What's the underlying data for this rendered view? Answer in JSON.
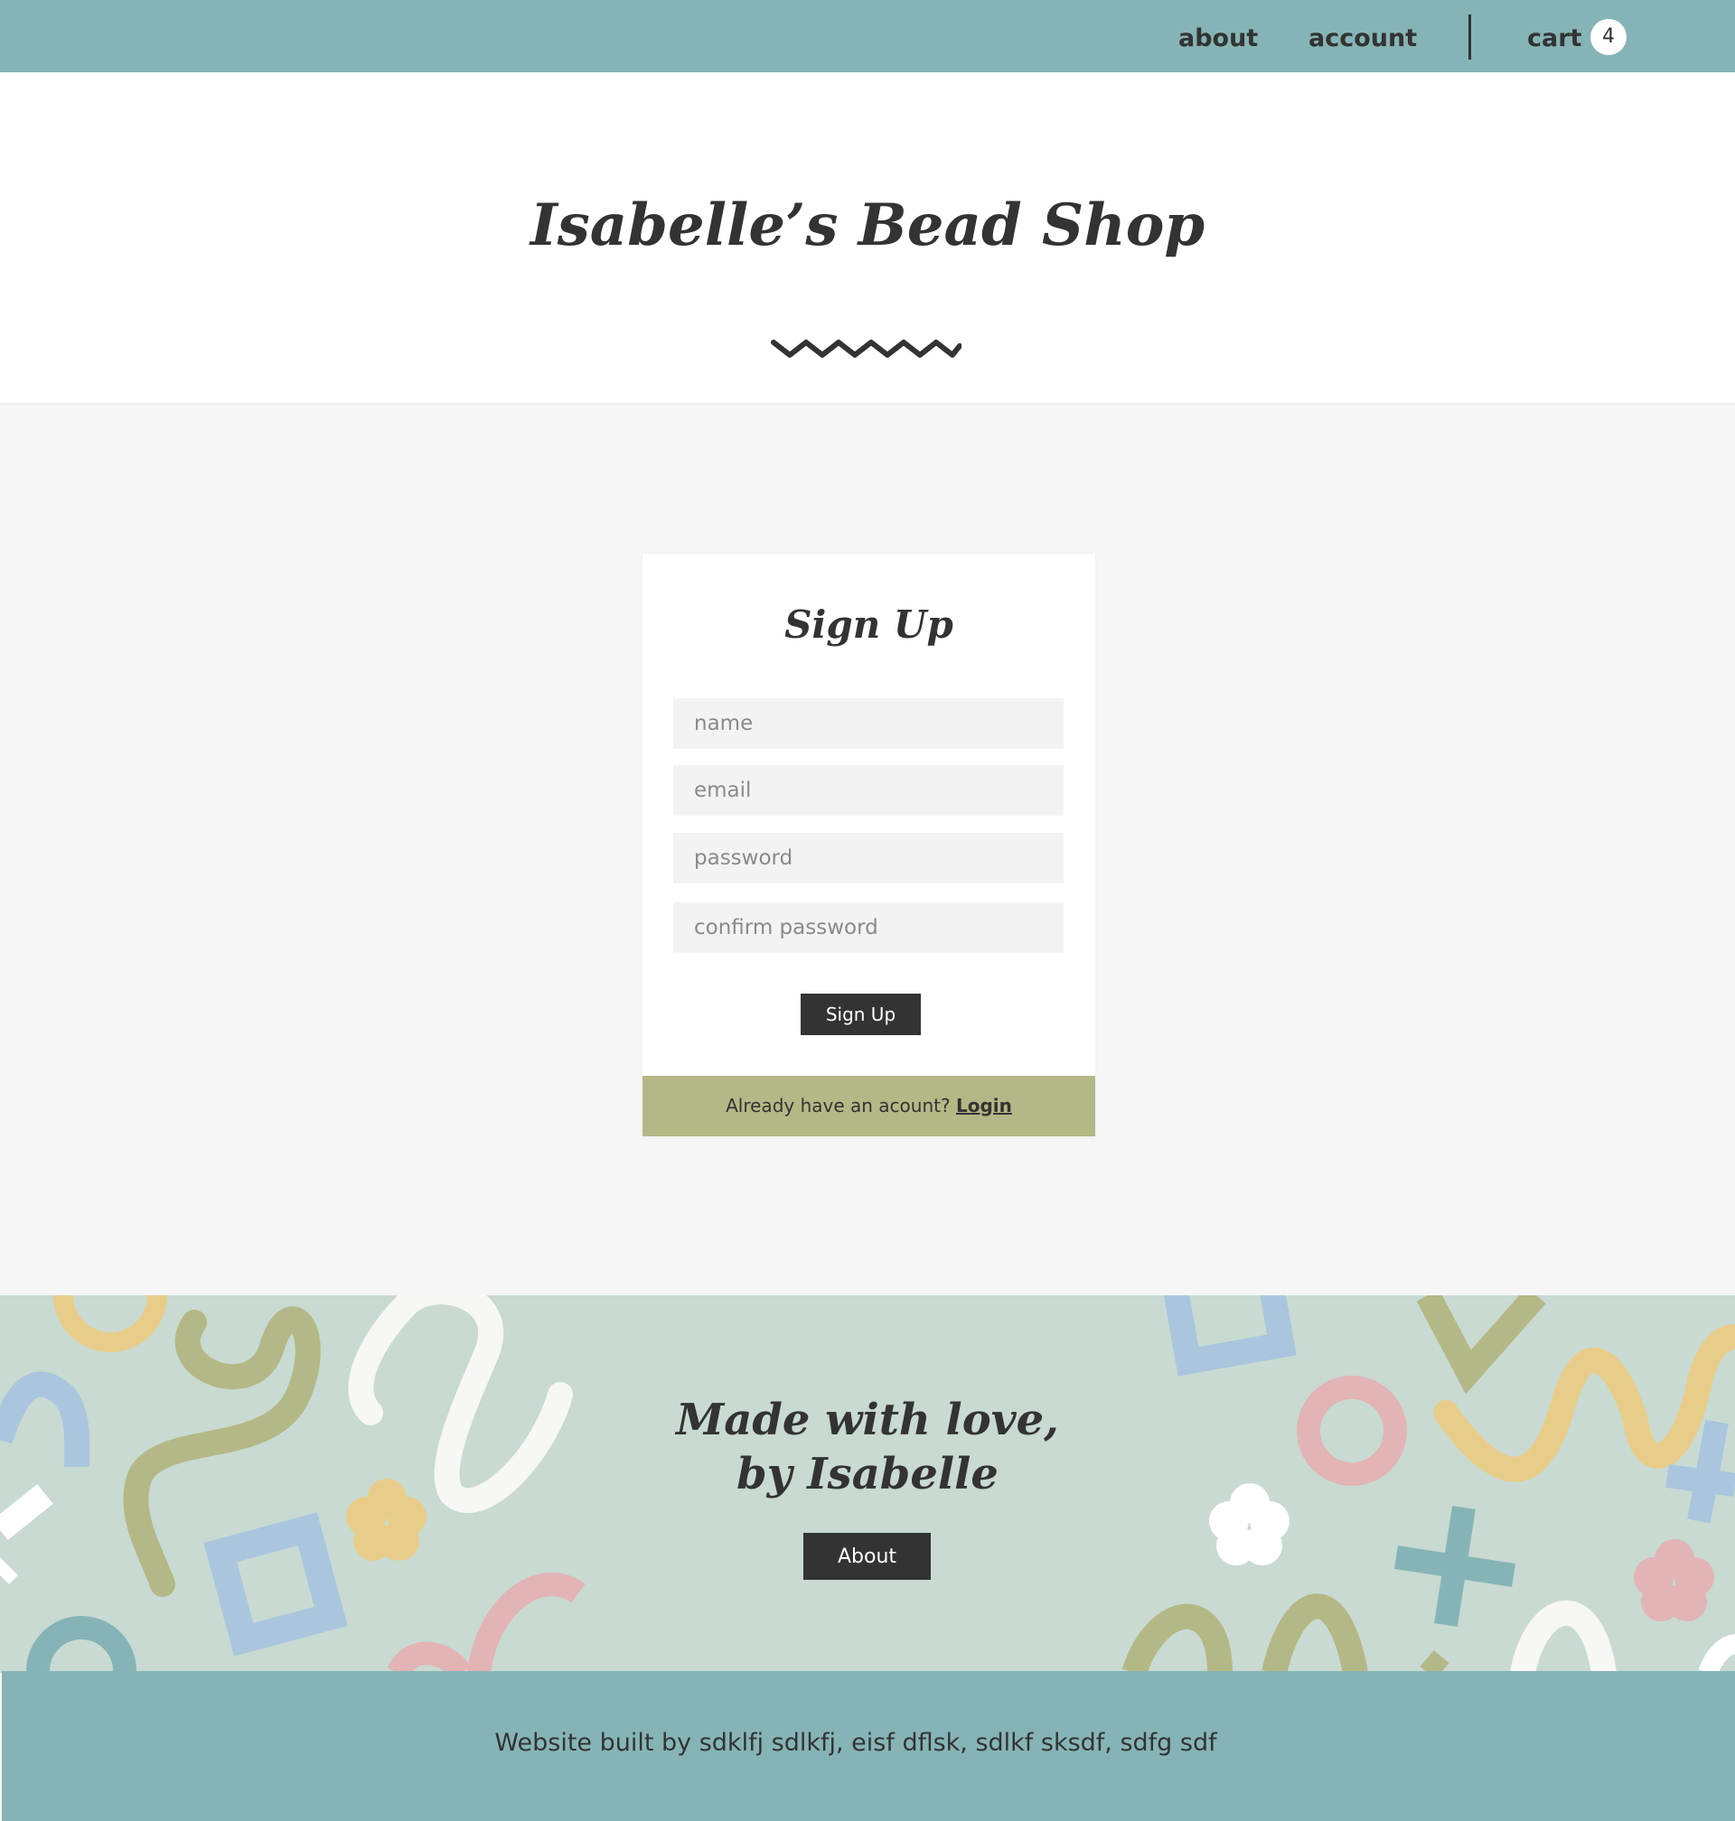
{
  "nav": {
    "about": "about",
    "account": "account",
    "cart": "cart",
    "cart_count": "4"
  },
  "header": {
    "title": "Isabelle’s Bead Shop"
  },
  "signup": {
    "heading": "Sign Up",
    "name_placeholder": "name",
    "email_placeholder": "email",
    "password_placeholder": "password",
    "confirm_placeholder": "confirm password",
    "submit_label": "Sign Up",
    "login_prompt": "Already have an acount?",
    "login_link": "Login"
  },
  "band": {
    "line1": "Made with love,",
    "line2": "by Isabelle",
    "about_button": "About"
  },
  "footer": {
    "credit": "Website built by sdklfj sdlkfj, eisf dflsk, sdlkf sksdf, sdfg sdf"
  },
  "colors": {
    "nav": "#86b4b6",
    "olive": "#b4b886",
    "band": "#c8dad2",
    "dark": "#333333"
  }
}
